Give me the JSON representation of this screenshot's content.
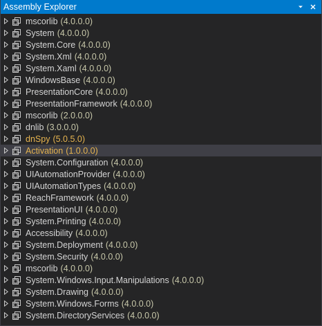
{
  "window": {
    "title": "Assembly Explorer",
    "dropdown_icon": "chevron-down-icon",
    "close_icon": "close-icon"
  },
  "colors": {
    "titlebar": "#007acc",
    "background": "#252526",
    "selected_row": "#3f3f46",
    "text": "#d4d4d4",
    "version_text": "#c8c8aa",
    "highlight_text": "#e6b450"
  },
  "assemblies": [
    {
      "name": "mscorlib",
      "version": "(4.0.0.0)"
    },
    {
      "name": "System",
      "version": "(4.0.0.0)"
    },
    {
      "name": "System.Core",
      "version": "(4.0.0.0)"
    },
    {
      "name": "System.Xml",
      "version": "(4.0.0.0)"
    },
    {
      "name": "System.Xaml",
      "version": "(4.0.0.0)"
    },
    {
      "name": "WindowsBase",
      "version": "(4.0.0.0)"
    },
    {
      "name": "PresentationCore",
      "version": "(4.0.0.0)"
    },
    {
      "name": "PresentationFramework",
      "version": "(4.0.0.0)"
    },
    {
      "name": "mscorlib",
      "version": "(2.0.0.0)"
    },
    {
      "name": "dnlib",
      "version": "(3.0.0.0)"
    },
    {
      "name": "dnSpy",
      "version": "(5.0.5.0)",
      "highlight": true
    },
    {
      "name": "Activation",
      "version": "(1.0.0.0)",
      "highlight": true,
      "selected": true
    },
    {
      "name": "System.Configuration",
      "version": "(4.0.0.0)"
    },
    {
      "name": "UIAutomationProvider",
      "version": "(4.0.0.0)"
    },
    {
      "name": "UIAutomationTypes",
      "version": "(4.0.0.0)"
    },
    {
      "name": "ReachFramework",
      "version": "(4.0.0.0)"
    },
    {
      "name": "PresentationUI",
      "version": "(4.0.0.0)"
    },
    {
      "name": "System.Printing",
      "version": "(4.0.0.0)"
    },
    {
      "name": "Accessibility",
      "version": "(4.0.0.0)"
    },
    {
      "name": "System.Deployment",
      "version": "(4.0.0.0)"
    },
    {
      "name": "System.Security",
      "version": "(4.0.0.0)"
    },
    {
      "name": "mscorlib",
      "version": "(4.0.0.0)"
    },
    {
      "name": "System.Windows.Input.Manipulations",
      "version": "(4.0.0.0)"
    },
    {
      "name": "System.Drawing",
      "version": "(4.0.0.0)"
    },
    {
      "name": "System.Windows.Forms",
      "version": "(4.0.0.0)"
    },
    {
      "name": "System.DirectoryServices",
      "version": "(4.0.0.0)"
    }
  ]
}
